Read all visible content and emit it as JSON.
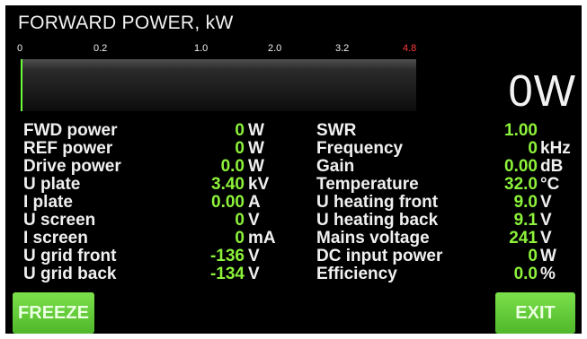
{
  "header": {
    "title": "FORWARD POWER, kW"
  },
  "scale": [
    "0",
    "0.2",
    "1.0",
    "2.0",
    "3.2",
    "4.8"
  ],
  "meter": {
    "level": 0,
    "readout": "0W"
  },
  "left_params": [
    {
      "label": "FWD power",
      "value": "0",
      "unit": "W"
    },
    {
      "label": "REF power",
      "value": "0",
      "unit": "W"
    },
    {
      "label": "Drive power",
      "value": "0.0",
      "unit": "W"
    },
    {
      "label": "U plate",
      "value": "3.40",
      "unit": "kV"
    },
    {
      "label": "I plate",
      "value": "0.00",
      "unit": "A"
    },
    {
      "label": "U screen",
      "value": "0",
      "unit": "V"
    },
    {
      "label": "I screen",
      "value": "0",
      "unit": "mA"
    },
    {
      "label": "U grid front",
      "value": "-136",
      "unit": "V"
    },
    {
      "label": "U grid back",
      "value": "-134",
      "unit": "V"
    }
  ],
  "right_params": [
    {
      "label": "SWR",
      "value": "1.00",
      "unit": ""
    },
    {
      "label": "Frequency",
      "value": "0",
      "unit": "kHz"
    },
    {
      "label": "Gain",
      "value": "0.00",
      "unit": "dB"
    },
    {
      "label": "Temperature",
      "value": "32.0",
      "unit": "°C"
    },
    {
      "label": "U heating front",
      "value": "9.0",
      "unit": "V"
    },
    {
      "label": "U heating back",
      "value": "9.1",
      "unit": "V"
    },
    {
      "label": "Mains voltage",
      "value": "241",
      "unit": "V"
    },
    {
      "label": "DC input power",
      "value": "0",
      "unit": "W"
    },
    {
      "label": "Efficiency",
      "value": "0.0",
      "unit": "%"
    }
  ],
  "buttons": {
    "freeze": "FREEZE",
    "exit": "EXIT"
  },
  "colors": {
    "value": "#8cf23a",
    "button": "#5cc532",
    "scale_max": "#ff3b3b"
  }
}
